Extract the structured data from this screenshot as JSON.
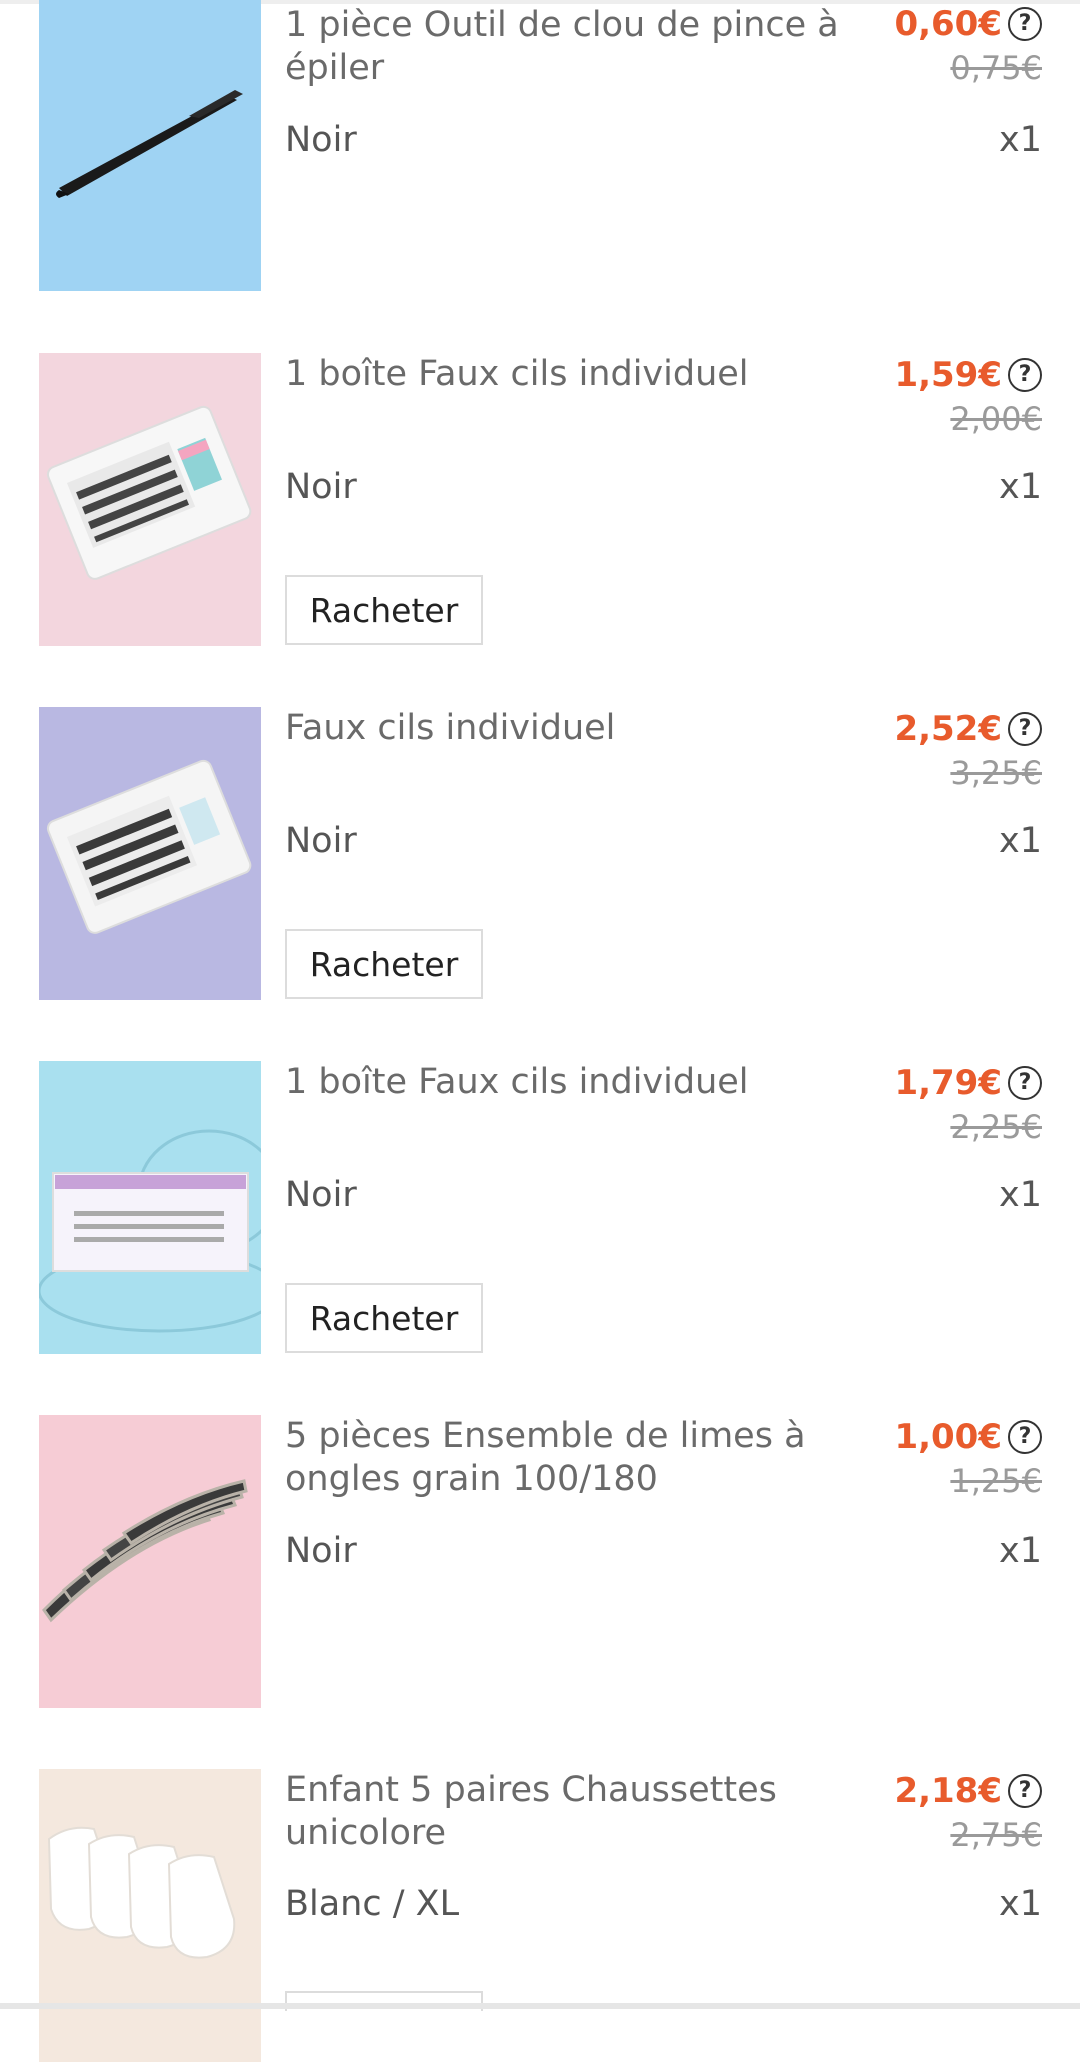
{
  "items": [
    {
      "title": "1 pièce Outil de clou de pince à épiler",
      "price": "0,60€",
      "old_price": "0,75€",
      "variant": "Noir",
      "qty": "x1"
    },
    {
      "title": "1 boîte Faux cils individuel",
      "price": "1,59€",
      "old_price": "2,00€",
      "variant": "Noir",
      "qty": "x1",
      "rebuy_label": "Racheter"
    },
    {
      "title": "Faux cils individuel",
      "price": "2,52€",
      "old_price": "3,25€",
      "variant": "Noir",
      "qty": "x1",
      "rebuy_label": "Racheter"
    },
    {
      "title": "1 boîte Faux cils individuel",
      "price": "1,79€",
      "old_price": "2,25€",
      "variant": "Noir",
      "qty": "x1",
      "rebuy_label": "Racheter"
    },
    {
      "title": "5 pièces Ensemble de limes à ongles grain 100/180",
      "price": "1,00€",
      "old_price": "1,25€",
      "variant": "Noir",
      "qty": "x1"
    },
    {
      "title": "Enfant 5 paires Chaussettes unicolore",
      "price": "2,18€",
      "old_price": "2,75€",
      "variant": "Blanc / XL",
      "qty": "x1"
    }
  ],
  "icons": {
    "help": "question-circle-icon"
  },
  "colors": {
    "price": "#e85b2c",
    "old_price": "#9a9a9a"
  }
}
